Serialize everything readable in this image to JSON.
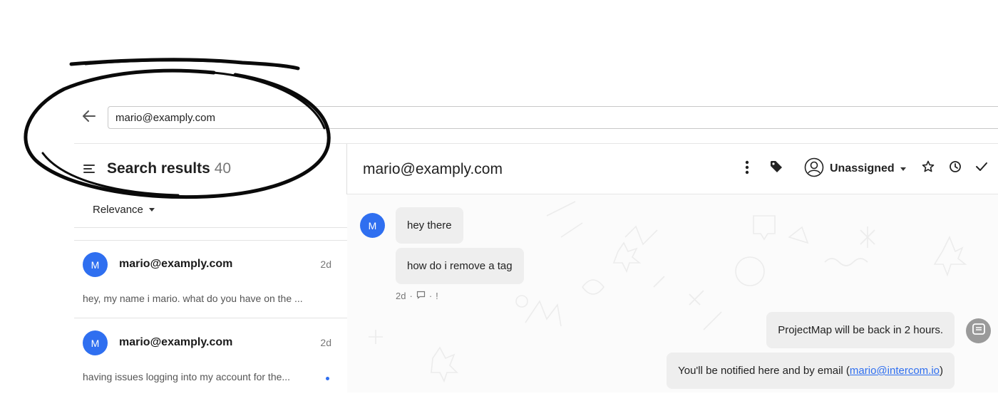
{
  "search": {
    "value": "mario@examply.com"
  },
  "list": {
    "title": "Search results",
    "count": "40",
    "sort_label": "Relevance",
    "conversations": [
      {
        "avatar": "M",
        "email": "mario@examply.com",
        "time": "2d",
        "preview": "hey, my name i mario. what do you have on the ...",
        "unread": false
      },
      {
        "avatar": "M",
        "email": "mario@examply.com",
        "time": "2d",
        "preview": "having issues logging into my account for the...",
        "unread": true
      }
    ]
  },
  "conversation": {
    "title": "mario@examply.com",
    "assignee": "Unassigned",
    "user_avatar": "M",
    "messages_in": [
      "hey there",
      "how do i remove a tag"
    ],
    "meta_time": "2d",
    "meta_flag": "!",
    "bot_message_1": "ProjectMap will be back in 2 hours.",
    "bot_message_2_prefix": "You'll be notified here and by email (",
    "bot_message_2_link": "mario@intercom.io",
    "bot_message_2_suffix": ")"
  },
  "icons": {
    "back": "arrow-left-icon",
    "menu": "hamburger-menu-icon",
    "more": "vertical-dots-icon",
    "tag": "tag-icon",
    "assignee": "user-circle-icon",
    "star": "star-icon",
    "snooze": "clock-icon",
    "close": "checkmark-icon",
    "bot": "chat-bot-icon"
  },
  "colors": {
    "accent": "#2f6ff0",
    "bubble": "#eeeeee",
    "bot_avatar": "#9a9a9a"
  }
}
